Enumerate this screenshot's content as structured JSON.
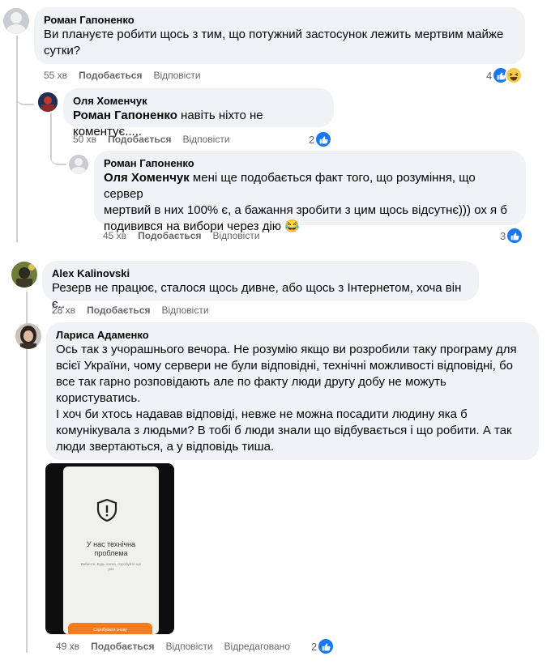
{
  "actions": {
    "like": "Подобається",
    "reply": "Відповісти",
    "edited": "Відредаговано"
  },
  "comments": [
    {
      "author": "Роман Гапоненко",
      "lines": [
        "Ви плануєте робити щось з тим, що потужний застосунок лежить мертвим майже",
        "сутки?"
      ],
      "time": "55 хв",
      "reactions": "4"
    },
    {
      "author": "Оля Хоменчук",
      "mention": "Роман Гапоненко",
      "text": " навіть ніхто не коментує.....",
      "time": "50 хв",
      "reactions": "2"
    },
    {
      "author": "Роман Гапоненко",
      "mention": "Оля Хоменчук",
      "line1": " мені ще подобається факт того, що розуміння, що сервер",
      "lines": [
        "мертвий в них 100% є, а бажання зробити з цим щось відсутнє))) ох я б",
        "подивився на вибори через дію"
      ],
      "emoji": "😂",
      "time": "45 хв",
      "reactions": "3"
    },
    {
      "author": "Alex Kalinovski",
      "lines": [
        "Резерв не працює, сталося щось дивне, або щось з Інтернетом, хоча він є.."
      ],
      "time": "28 хв"
    },
    {
      "author": "Лариса Адаменко",
      "lines": [
        "Ось так з учорашнього вечора. Не розумію якщо ви розробили таку програму для",
        "всієї України, чому сервери не були відповідні, технічні можливості відповідні, бо",
        "все так гарно розповідають але по факту люди другу добу не можуть",
        "користуватись.",
        "І хоч би хтось надавав відповіді, невже не можна посадити людину яка б",
        "комунікувала з людьми? В тобі б люди знали що відбувається і що робити. А так",
        "люди звертаються, а у відповідь тиша."
      ],
      "time": "49 хв",
      "reactions": "2",
      "photo": {
        "title_line1": "У нас технічна",
        "title_line2": "проблема",
        "subtitle_line1": "Вибачте. Будь ласка, спробуйте ще",
        "subtitle_line2": "раз",
        "button": "Спробувати знову"
      }
    }
  ],
  "colors": {
    "bubble": "#f0f2f5",
    "meta": "#65676b",
    "like": "#1877f2",
    "haha": "#f7c948",
    "photo_button": "#f47c20"
  }
}
